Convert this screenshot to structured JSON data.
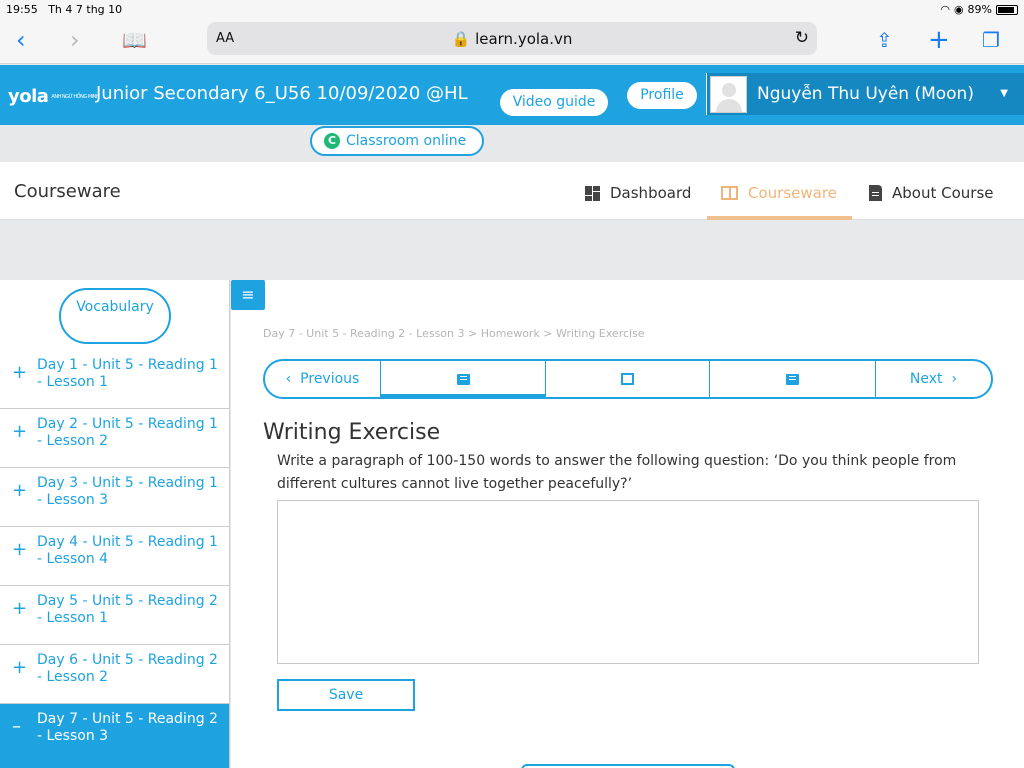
{
  "status_bar": {
    "time": "19:55",
    "date": "Th 4 7 thg 10",
    "battery": "89%",
    "battery_level": 0.89
  },
  "browser": {
    "text_size": "AA",
    "url": "learn.yola.vn"
  },
  "header": {
    "logo": "yola",
    "logo_sub": "ANH NGỮ HỒNG MINH",
    "course_title": "Junior Secondary 6_U56 10/09/2020 @HL",
    "video_guide": "Video guide",
    "profile": "Profile",
    "user_name": "Nguyễn Thu Uyên (Moon)",
    "classroom_online": "Classroom online"
  },
  "courseware_nav": {
    "title": "Courseware",
    "tabs": [
      {
        "label": "Dashboard"
      },
      {
        "label": "Courseware"
      },
      {
        "label": "About Course"
      }
    ]
  },
  "sidebar": {
    "vocab_button": "Vocabulary",
    "items": [
      {
        "sign": "+",
        "label": "Day 1 - Unit 5 - Reading 1 - Lesson 1"
      },
      {
        "sign": "+",
        "label": "Day 2 - Unit 5 - Reading 1 - Lesson 2"
      },
      {
        "sign": "+",
        "label": "Day 3 - Unit 5 - Reading 1 - Lesson 3"
      },
      {
        "sign": "+",
        "label": "Day 4 - Unit 5 - Reading 1 - Lesson 4"
      },
      {
        "sign": "+",
        "label": "Day 5 - Unit 5 - Reading 2 - Lesson 1"
      },
      {
        "sign": "+",
        "label": "Day 6 - Unit 5 - Reading 2 - Lesson 2"
      },
      {
        "sign": "–",
        "label": "Day 7 - Unit 5 - Reading 2 - Lesson 3"
      }
    ]
  },
  "main": {
    "toggle": "≡",
    "breadcrumb": "Day 7 - Unit 5 - Reading 2 - Lesson 3 > Homework > Writing Exercise",
    "seq_nav": {
      "previous": "Previous",
      "next": "Next"
    },
    "exercise_title": "Writing Exercise",
    "prompt": "Write a paragraph of 100-150 words to answer the following question: ‘Do you think people from different cultures cannot live together peacefully?’",
    "answer": "",
    "save": "Save"
  }
}
